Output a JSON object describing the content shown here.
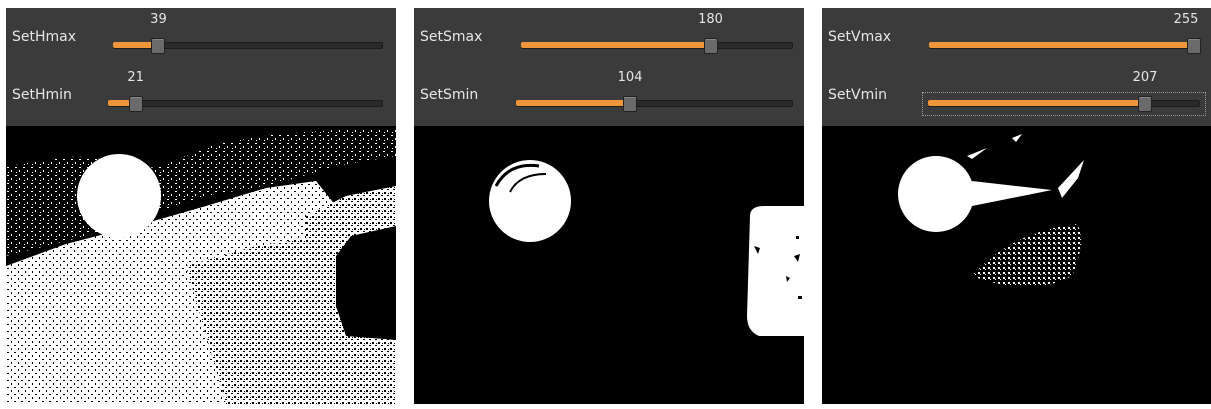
{
  "windows": [
    {
      "sliders": [
        {
          "label": "SetHmax",
          "value": 39,
          "max": 255
        },
        {
          "label": "SetHmin",
          "value": 21,
          "max": 255
        }
      ]
    },
    {
      "sliders": [
        {
          "label": "SetSmax",
          "value": 180,
          "max": 255
        },
        {
          "label": "SetSmin",
          "value": 104,
          "max": 255
        }
      ]
    },
    {
      "sliders": [
        {
          "label": "SetVmax",
          "value": 255,
          "max": 255
        },
        {
          "label": "SetVmin",
          "value": 207,
          "max": 255
        }
      ]
    }
  ],
  "colors": {
    "toolbar_bg": "#3b3b3b",
    "slider_fill": "#f0963a",
    "label_text": "#e6e6e6",
    "mask_bg": "#000000",
    "mask_fg": "#ffffff"
  }
}
